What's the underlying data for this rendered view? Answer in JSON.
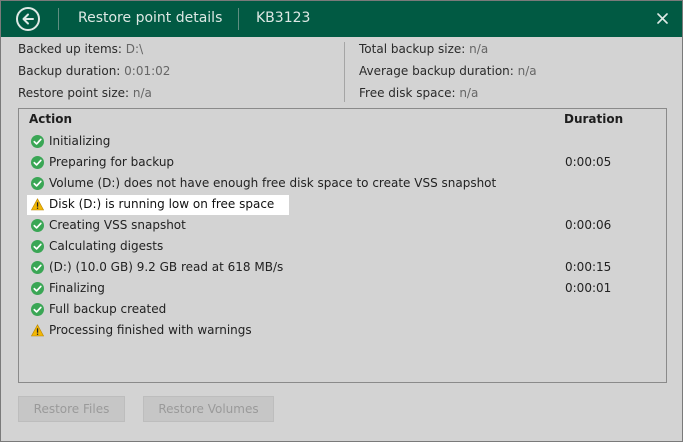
{
  "titlebar": {
    "title": "Restore point details",
    "update": "KB3123"
  },
  "info": {
    "backed_up_items_label": "Backed up items:",
    "backed_up_items_value": "D:\\",
    "backup_duration_label": "Backup duration:",
    "backup_duration_value": "0:01:02",
    "restore_point_size_label": "Restore point size:",
    "restore_point_size_value": "n/a",
    "total_backup_size_label": "Total backup size:",
    "total_backup_size_value": "n/a",
    "avg_backup_duration_label": "Average backup duration:",
    "avg_backup_duration_value": "n/a",
    "free_disk_space_label": "Free disk space:",
    "free_disk_space_value": "n/a"
  },
  "log": {
    "col_action": "Action",
    "col_duration": "Duration",
    "rows": [
      {
        "icon": "success-icon",
        "message": "Initializing",
        "duration": ""
      },
      {
        "icon": "success-icon",
        "message": "Preparing for backup",
        "duration": "0:00:05"
      },
      {
        "icon": "success-icon",
        "message": "Volume (D:) does not have enough free disk space to create VSS snapshot",
        "duration": ""
      },
      {
        "icon": "warning-icon",
        "message": "Disk (D:) is running low on free space",
        "duration": ""
      },
      {
        "icon": "success-icon",
        "message": "Creating VSS snapshot",
        "duration": "0:00:06"
      },
      {
        "icon": "success-icon",
        "message": "Calculating digests",
        "duration": ""
      },
      {
        "icon": "success-icon",
        "message": "(D:) (10.0 GB) 9.2 GB read at 618 MB/s",
        "duration": "0:00:15"
      },
      {
        "icon": "success-icon",
        "message": "Finalizing",
        "duration": "0:00:01"
      },
      {
        "icon": "success-icon",
        "message": "Full backup created",
        "duration": ""
      },
      {
        "icon": "warning-icon",
        "message": "Processing finished with warnings",
        "duration": ""
      }
    ]
  },
  "buttons": {
    "restore_files": "Restore Files",
    "restore_volumes": "Restore Volumes"
  },
  "colors": {
    "titlebar": "#015a43",
    "success": "#3aa655",
    "warning": "#f2b705"
  }
}
